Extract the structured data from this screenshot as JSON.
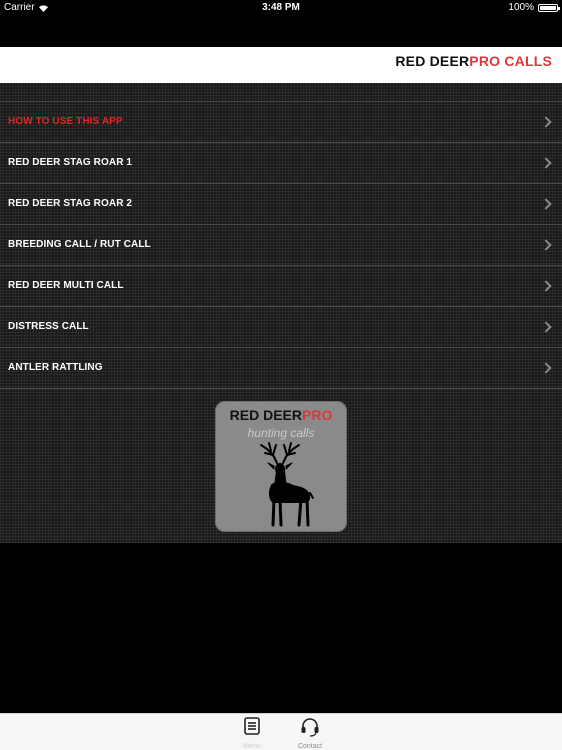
{
  "status_bar": {
    "carrier": "Carrier",
    "time": "3:48 PM",
    "battery": "100%",
    "battery_level": 1.0
  },
  "header": {
    "title_part1": "RED DEER",
    "title_part2": "PRO CALLS"
  },
  "menu": {
    "items": [
      {
        "label": "HOW TO USE THIS APP"
      },
      {
        "label": "RED DEER STAG ROAR 1"
      },
      {
        "label": "RED DEER STAG ROAR 2"
      },
      {
        "label": "BREEDING CALL / RUT CALL"
      },
      {
        "label": "RED DEER MULTI CALL"
      },
      {
        "label": "DISTRESS CALL"
      },
      {
        "label": "ANTLER RATTLING"
      }
    ]
  },
  "logo": {
    "title_part1": "RED DEER",
    "title_part2": "PRO",
    "subtitle": "hunting calls",
    "icon": "deer-silhouette-icon"
  },
  "tab_bar": {
    "tabs": [
      {
        "label": "Menu",
        "icon": "menu-list-icon"
      },
      {
        "label": "Contact",
        "icon": "headset-icon"
      }
    ]
  },
  "colors": {
    "accent_red": "#d63b3b",
    "highlight_red": "#e02525",
    "background": "#000000",
    "header_bg": "#ffffff",
    "logo_tile": "#8a8a8a"
  }
}
